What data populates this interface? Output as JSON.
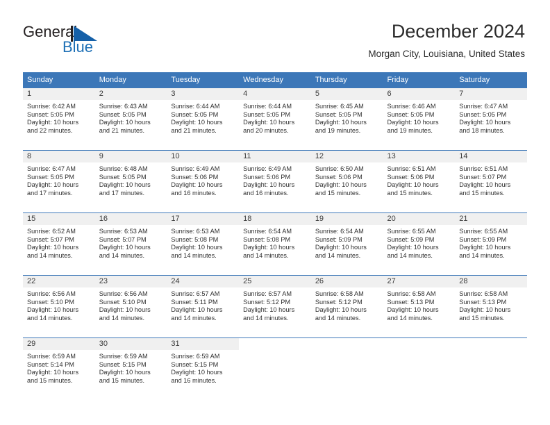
{
  "brand": {
    "name_top": "General",
    "name_bottom": "Blue",
    "triangle_color": "#1560a8",
    "blue_text_color": "#1c6fb5"
  },
  "header": {
    "title": "December 2024",
    "subtitle": "Morgan City, Louisiana, United States"
  },
  "theme": {
    "header_blue": "#3c77b8",
    "daynum_band": "#f0f0f0",
    "text": "#2f2f2f"
  },
  "weekday_headers": [
    "Sunday",
    "Monday",
    "Tuesday",
    "Wednesday",
    "Thursday",
    "Friday",
    "Saturday"
  ],
  "weeks": [
    [
      {
        "day": "1",
        "sunrise": "Sunrise: 6:42 AM",
        "sunset": "Sunset: 5:05 PM",
        "daylight_line1": "Daylight: 10 hours",
        "daylight_line2": "and 22 minutes."
      },
      {
        "day": "2",
        "sunrise": "Sunrise: 6:43 AM",
        "sunset": "Sunset: 5:05 PM",
        "daylight_line1": "Daylight: 10 hours",
        "daylight_line2": "and 21 minutes."
      },
      {
        "day": "3",
        "sunrise": "Sunrise: 6:44 AM",
        "sunset": "Sunset: 5:05 PM",
        "daylight_line1": "Daylight: 10 hours",
        "daylight_line2": "and 21 minutes."
      },
      {
        "day": "4",
        "sunrise": "Sunrise: 6:44 AM",
        "sunset": "Sunset: 5:05 PM",
        "daylight_line1": "Daylight: 10 hours",
        "daylight_line2": "and 20 minutes."
      },
      {
        "day": "5",
        "sunrise": "Sunrise: 6:45 AM",
        "sunset": "Sunset: 5:05 PM",
        "daylight_line1": "Daylight: 10 hours",
        "daylight_line2": "and 19 minutes."
      },
      {
        "day": "6",
        "sunrise": "Sunrise: 6:46 AM",
        "sunset": "Sunset: 5:05 PM",
        "daylight_line1": "Daylight: 10 hours",
        "daylight_line2": "and 19 minutes."
      },
      {
        "day": "7",
        "sunrise": "Sunrise: 6:47 AM",
        "sunset": "Sunset: 5:05 PM",
        "daylight_line1": "Daylight: 10 hours",
        "daylight_line2": "and 18 minutes."
      }
    ],
    [
      {
        "day": "8",
        "sunrise": "Sunrise: 6:47 AM",
        "sunset": "Sunset: 5:05 PM",
        "daylight_line1": "Daylight: 10 hours",
        "daylight_line2": "and 17 minutes."
      },
      {
        "day": "9",
        "sunrise": "Sunrise: 6:48 AM",
        "sunset": "Sunset: 5:05 PM",
        "daylight_line1": "Daylight: 10 hours",
        "daylight_line2": "and 17 minutes."
      },
      {
        "day": "10",
        "sunrise": "Sunrise: 6:49 AM",
        "sunset": "Sunset: 5:06 PM",
        "daylight_line1": "Daylight: 10 hours",
        "daylight_line2": "and 16 minutes."
      },
      {
        "day": "11",
        "sunrise": "Sunrise: 6:49 AM",
        "sunset": "Sunset: 5:06 PM",
        "daylight_line1": "Daylight: 10 hours",
        "daylight_line2": "and 16 minutes."
      },
      {
        "day": "12",
        "sunrise": "Sunrise: 6:50 AM",
        "sunset": "Sunset: 5:06 PM",
        "daylight_line1": "Daylight: 10 hours",
        "daylight_line2": "and 15 minutes."
      },
      {
        "day": "13",
        "sunrise": "Sunrise: 6:51 AM",
        "sunset": "Sunset: 5:06 PM",
        "daylight_line1": "Daylight: 10 hours",
        "daylight_line2": "and 15 minutes."
      },
      {
        "day": "14",
        "sunrise": "Sunrise: 6:51 AM",
        "sunset": "Sunset: 5:07 PM",
        "daylight_line1": "Daylight: 10 hours",
        "daylight_line2": "and 15 minutes."
      }
    ],
    [
      {
        "day": "15",
        "sunrise": "Sunrise: 6:52 AM",
        "sunset": "Sunset: 5:07 PM",
        "daylight_line1": "Daylight: 10 hours",
        "daylight_line2": "and 14 minutes."
      },
      {
        "day": "16",
        "sunrise": "Sunrise: 6:53 AM",
        "sunset": "Sunset: 5:07 PM",
        "daylight_line1": "Daylight: 10 hours",
        "daylight_line2": "and 14 minutes."
      },
      {
        "day": "17",
        "sunrise": "Sunrise: 6:53 AM",
        "sunset": "Sunset: 5:08 PM",
        "daylight_line1": "Daylight: 10 hours",
        "daylight_line2": "and 14 minutes."
      },
      {
        "day": "18",
        "sunrise": "Sunrise: 6:54 AM",
        "sunset": "Sunset: 5:08 PM",
        "daylight_line1": "Daylight: 10 hours",
        "daylight_line2": "and 14 minutes."
      },
      {
        "day": "19",
        "sunrise": "Sunrise: 6:54 AM",
        "sunset": "Sunset: 5:09 PM",
        "daylight_line1": "Daylight: 10 hours",
        "daylight_line2": "and 14 minutes."
      },
      {
        "day": "20",
        "sunrise": "Sunrise: 6:55 AM",
        "sunset": "Sunset: 5:09 PM",
        "daylight_line1": "Daylight: 10 hours",
        "daylight_line2": "and 14 minutes."
      },
      {
        "day": "21",
        "sunrise": "Sunrise: 6:55 AM",
        "sunset": "Sunset: 5:09 PM",
        "daylight_line1": "Daylight: 10 hours",
        "daylight_line2": "and 14 minutes."
      }
    ],
    [
      {
        "day": "22",
        "sunrise": "Sunrise: 6:56 AM",
        "sunset": "Sunset: 5:10 PM",
        "daylight_line1": "Daylight: 10 hours",
        "daylight_line2": "and 14 minutes."
      },
      {
        "day": "23",
        "sunrise": "Sunrise: 6:56 AM",
        "sunset": "Sunset: 5:10 PM",
        "daylight_line1": "Daylight: 10 hours",
        "daylight_line2": "and 14 minutes."
      },
      {
        "day": "24",
        "sunrise": "Sunrise: 6:57 AM",
        "sunset": "Sunset: 5:11 PM",
        "daylight_line1": "Daylight: 10 hours",
        "daylight_line2": "and 14 minutes."
      },
      {
        "day": "25",
        "sunrise": "Sunrise: 6:57 AM",
        "sunset": "Sunset: 5:12 PM",
        "daylight_line1": "Daylight: 10 hours",
        "daylight_line2": "and 14 minutes."
      },
      {
        "day": "26",
        "sunrise": "Sunrise: 6:58 AM",
        "sunset": "Sunset: 5:12 PM",
        "daylight_line1": "Daylight: 10 hours",
        "daylight_line2": "and 14 minutes."
      },
      {
        "day": "27",
        "sunrise": "Sunrise: 6:58 AM",
        "sunset": "Sunset: 5:13 PM",
        "daylight_line1": "Daylight: 10 hours",
        "daylight_line2": "and 14 minutes."
      },
      {
        "day": "28",
        "sunrise": "Sunrise: 6:58 AM",
        "sunset": "Sunset: 5:13 PM",
        "daylight_line1": "Daylight: 10 hours",
        "daylight_line2": "and 15 minutes."
      }
    ],
    [
      {
        "day": "29",
        "sunrise": "Sunrise: 6:59 AM",
        "sunset": "Sunset: 5:14 PM",
        "daylight_line1": "Daylight: 10 hours",
        "daylight_line2": "and 15 minutes."
      },
      {
        "day": "30",
        "sunrise": "Sunrise: 6:59 AM",
        "sunset": "Sunset: 5:15 PM",
        "daylight_line1": "Daylight: 10 hours",
        "daylight_line2": "and 15 minutes."
      },
      {
        "day": "31",
        "sunrise": "Sunrise: 6:59 AM",
        "sunset": "Sunset: 5:15 PM",
        "daylight_line1": "Daylight: 10 hours",
        "daylight_line2": "and 16 minutes."
      },
      {
        "day": "",
        "sunrise": "",
        "sunset": "",
        "daylight_line1": "",
        "daylight_line2": ""
      },
      {
        "day": "",
        "sunrise": "",
        "sunset": "",
        "daylight_line1": "",
        "daylight_line2": ""
      },
      {
        "day": "",
        "sunrise": "",
        "sunset": "",
        "daylight_line1": "",
        "daylight_line2": ""
      },
      {
        "day": "",
        "sunrise": "",
        "sunset": "",
        "daylight_line1": "",
        "daylight_line2": ""
      }
    ]
  ]
}
